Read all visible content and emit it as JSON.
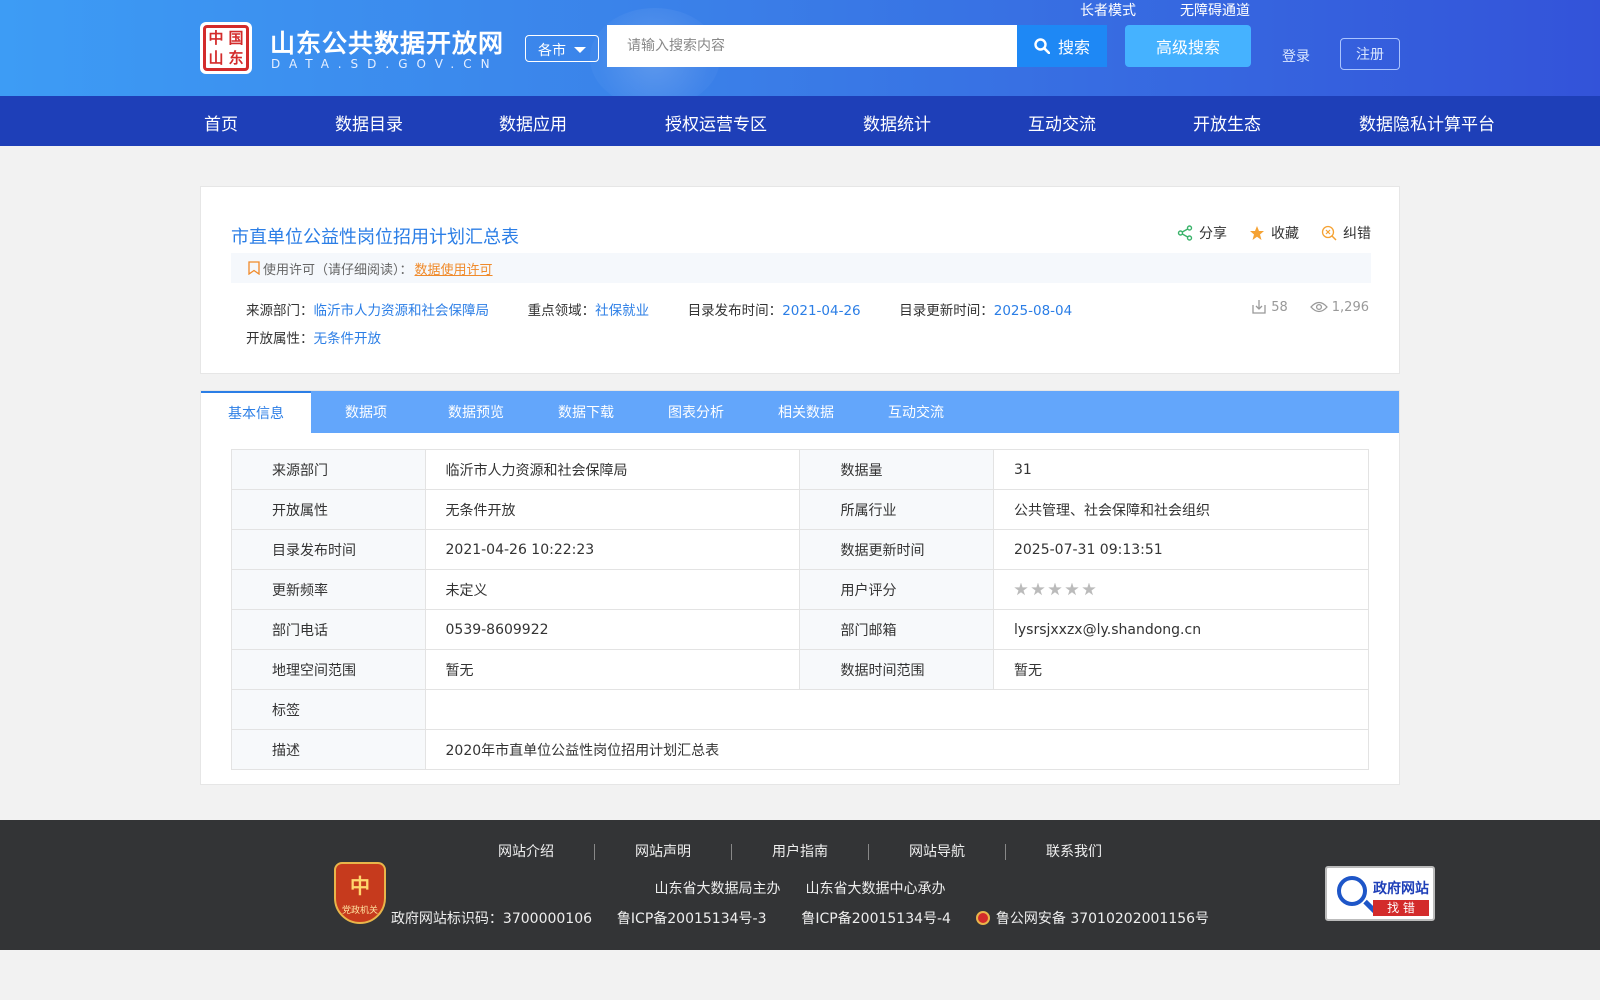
{
  "header": {
    "logo_chars": [
      "中",
      "国",
      "山",
      "东"
    ],
    "site_title": "山东公共数据开放网",
    "site_domain": "DATA.SD.GOV.CN",
    "city_select": "各市",
    "search_placeholder": "请输入搜索内容",
    "search_button": "搜索",
    "advanced_search": "高级搜索",
    "elder_mode": "长者模式",
    "accessibility": "无障碍通道",
    "login": "登录",
    "register": "注册"
  },
  "nav": [
    "首页",
    "数据目录",
    "数据应用",
    "授权运营专区",
    "数据统计",
    "互动交流",
    "开放生态",
    "数据隐私计算平台"
  ],
  "dataset": {
    "title": "市直单位公益性岗位招用计划汇总表",
    "actions": {
      "share": "分享",
      "favorite": "收藏",
      "report": "纠错"
    },
    "license_label": "使用许可（请仔细阅读）：",
    "license_link": "数据使用许可",
    "source_label": "来源部门：",
    "source_value": "临沂市人力资源和社会保障局",
    "domain_label": "重点领域：",
    "domain_value": "社保就业",
    "publish_label": "目录发布时间：",
    "publish_value": "2021-04-26",
    "update_label": "目录更新时间：",
    "update_value": "2025-08-04",
    "open_label": "开放属性：",
    "open_value": "无条件开放",
    "downloads": "58",
    "views": "1,296"
  },
  "tabs": [
    "基本信息",
    "数据项",
    "数据预览",
    "数据下载",
    "图表分析",
    "相关数据",
    "互动交流"
  ],
  "info": {
    "r1": [
      "来源部门",
      "临沂市人力资源和社会保障局",
      "数据量",
      "31"
    ],
    "r2": [
      "开放属性",
      "无条件开放",
      "所属行业",
      "公共管理、社会保障和社会组织"
    ],
    "r3": [
      "目录发布时间",
      "2021-04-26 10:22:23",
      "数据更新时间",
      "2025-07-31 09:13:51"
    ],
    "r4": [
      "更新频率",
      "未定义",
      "用户评分"
    ],
    "rating": 0,
    "r5": [
      "部门电话",
      "0539-8609922",
      "部门邮箱",
      "lysrsjxxzx@ly.shandong.cn"
    ],
    "r6": [
      "地理空间范围",
      "暂无",
      "数据时间范围",
      "暂无"
    ],
    "r7": [
      "标签",
      ""
    ],
    "r8": [
      "描述",
      "2020年市直单位公益性岗位招用计划汇总表"
    ]
  },
  "footer": {
    "links": [
      "网站介绍",
      "网站声明",
      "用户指南",
      "网站导航",
      "联系我们"
    ],
    "host": "山东省大数据局主办",
    "organizer": "山东省大数据中心承办",
    "site_id": "政府网站标识码：3700000106",
    "icp1": "鲁ICP备20015134号-3",
    "icp2": "鲁ICP备20015134号-4",
    "police": "鲁公网安备 37010202001156号",
    "party_badge": "党政机关",
    "findbug_title": "政府网站",
    "findbug_sub": "找 错"
  },
  "colors": {
    "accent": "#2b7ee6",
    "nav": "#1e3fb8",
    "license_link": "#f08a2a",
    "footer": "#333436"
  }
}
